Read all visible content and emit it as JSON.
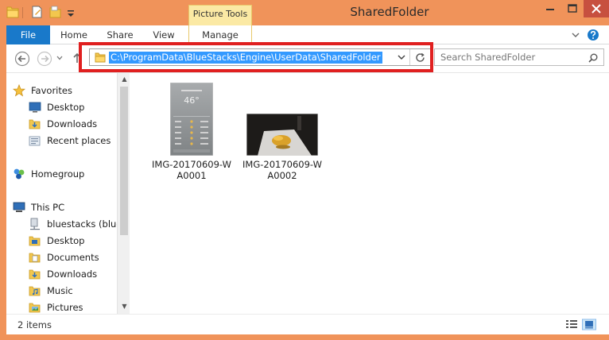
{
  "window": {
    "title": "SharedFolder",
    "contextual_tab": "Picture Tools",
    "accent": "#f0935a"
  },
  "quick_access": [
    "folder-icon",
    "properties-icon",
    "new-folder-icon",
    "customize-qat-icon"
  ],
  "caption_buttons": [
    "minimize-icon",
    "maximize-icon",
    "close-icon"
  ],
  "ribbon": {
    "tabs": [
      {
        "label": "File"
      },
      {
        "label": "Home"
      },
      {
        "label": "Share"
      },
      {
        "label": "View"
      },
      {
        "label": "Manage"
      }
    ],
    "file_tab_color": "#1979ca"
  },
  "address": {
    "path": "C:\\ProgramData\\BlueStacks\\Engine\\UserData\\SharedFolder",
    "highlight_color": "#e02020"
  },
  "search": {
    "placeholder": "Search SharedFolder"
  },
  "navigation": {
    "favorites": {
      "label": "Favorites",
      "items": [
        {
          "label": "Desktop",
          "icon": "desktop-icon"
        },
        {
          "label": "Downloads",
          "icon": "downloads-icon"
        },
        {
          "label": "Recent places",
          "icon": "recent-places-icon"
        }
      ]
    },
    "homegroup": {
      "label": "Homegroup",
      "icon": "homegroup-icon"
    },
    "this_pc": {
      "label": "This PC",
      "items": [
        {
          "label": "bluestacks (blues",
          "icon": "network-drive-icon"
        },
        {
          "label": "Desktop",
          "icon": "desktop-folder-icon"
        },
        {
          "label": "Documents",
          "icon": "documents-icon"
        },
        {
          "label": "Downloads",
          "icon": "downloads-folder-icon"
        },
        {
          "label": "Music",
          "icon": "music-icon"
        },
        {
          "label": "Pictures",
          "icon": "pictures-icon"
        }
      ]
    }
  },
  "files": [
    {
      "name_line1": "IMG-20170609-W",
      "name_line2": "A0001",
      "thumbnail": "weather-screenshot",
      "thumb_text": "46°"
    },
    {
      "name_line1": "IMG-20170609-W",
      "name_line2": "A0002",
      "thumbnail": "dark-photo"
    }
  ],
  "status": {
    "item_count": "2 items"
  }
}
